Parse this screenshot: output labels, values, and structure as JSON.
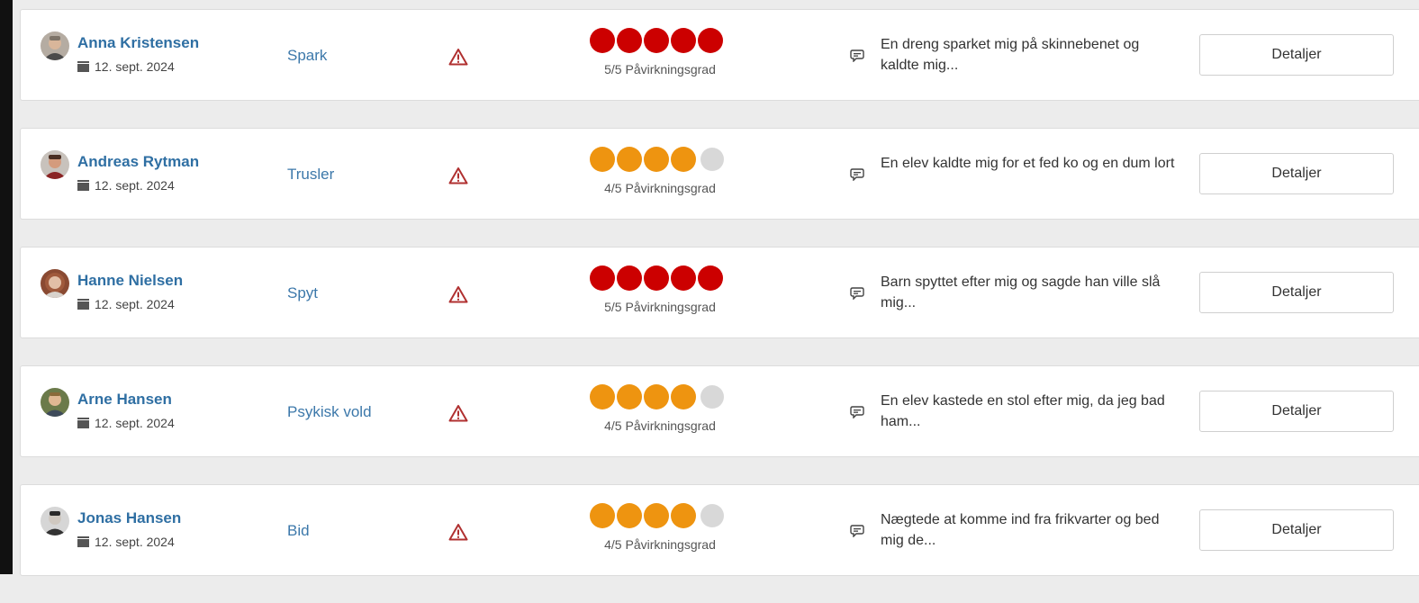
{
  "incidents": [
    {
      "name": "Anna Kristensen",
      "date": "12. sept. 2024",
      "category": "Spark",
      "severity": 5,
      "severity_label": "5/5 Påvirkningsgrad",
      "dot_color": "#cc0000",
      "comment": "En dreng sparket mig på skinnebenet og kaldte mig...",
      "details_label": "Detaljer"
    },
    {
      "name": "Andreas Rytman",
      "date": "12. sept. 2024",
      "category": "Trusler",
      "severity": 4,
      "severity_label": "4/5 Påvirkningsgrad",
      "dot_color": "#ee9410",
      "comment": "En elev kaldte mig for et fed ko og en dum lort",
      "details_label": "Detaljer"
    },
    {
      "name": "Hanne Nielsen",
      "date": "12. sept. 2024",
      "category": "Spyt",
      "severity": 5,
      "severity_label": "5/5 Påvirkningsgrad",
      "dot_color": "#cc0000",
      "comment": "Barn spyttet efter mig og sagde han ville slå mig...",
      "details_label": "Detaljer"
    },
    {
      "name": "Arne Hansen",
      "date": "12. sept. 2024",
      "category": "Psykisk vold",
      "severity": 4,
      "severity_label": "4/5 Påvirkningsgrad",
      "dot_color": "#ee9410",
      "comment": "En elev kastede en stol efter mig, da jeg bad ham...",
      "details_label": "Detaljer"
    },
    {
      "name": "Jonas Hansen",
      "date": "12. sept. 2024",
      "category": "Bid",
      "severity": 4,
      "severity_label": "4/5 Påvirkningsgrad",
      "dot_color": "#ee9410",
      "comment": "Nægtede at komme ind fra frikvarter og bed mig de...",
      "details_label": "Detaljer"
    }
  ],
  "colors": {
    "name_link": "#2f6fa3",
    "category_link": "#3c78aa",
    "warning_icon": "#b03030",
    "empty_dot": "#d8d8d8"
  },
  "icons": {
    "date": "calendar-icon",
    "category": "warning-triangle-icon",
    "comment": "speech-bubble-icon"
  }
}
